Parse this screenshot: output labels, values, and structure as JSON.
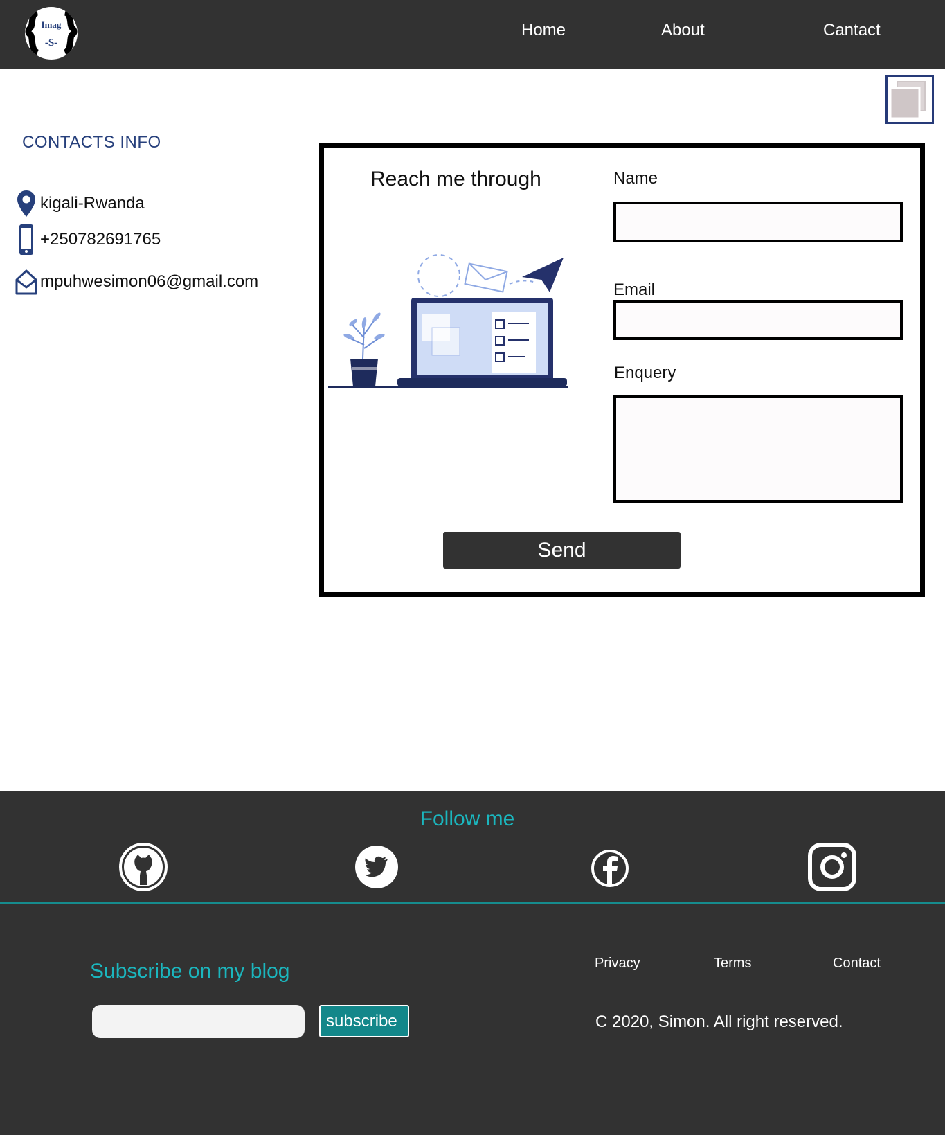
{
  "header": {
    "logo": {
      "line1": "Imag",
      "line2": "-S-",
      "icon": "logo-icon"
    },
    "nav": [
      {
        "label": "Home"
      },
      {
        "label": "About"
      },
      {
        "label": "Cantact"
      }
    ]
  },
  "corner_button": {
    "icon": "copy-icon"
  },
  "contacts": {
    "title": "CONTACTS INFO",
    "items": [
      {
        "icon": "location-pin-icon",
        "text": "kigali-Rwanda"
      },
      {
        "icon": "phone-icon",
        "text": "+250782691765"
      },
      {
        "icon": "envelope-icon",
        "text": "mpuhwesimon06@gmail.com"
      }
    ]
  },
  "form": {
    "title": "Reach me through",
    "illustration": "laptop-mail-illustration",
    "name_label": "Name",
    "name_value": "",
    "email_label": "Email",
    "email_value": "",
    "enquery_label": "Enquery",
    "enquery_value": "",
    "send_label": "Send"
  },
  "footer": {
    "follow_title": "Follow me",
    "social": [
      {
        "icon": "github-icon"
      },
      {
        "icon": "twitter-icon"
      },
      {
        "icon": "facebook-icon"
      },
      {
        "icon": "instagram-icon"
      }
    ],
    "subscribe_title": "Subscribe on my blog",
    "subscribe_value": "",
    "subscribe_label": "subscribe",
    "links": [
      {
        "label": "Privacy"
      },
      {
        "label": "Terms"
      },
      {
        "label": "Contact"
      }
    ],
    "copyright": "C 2020, Simon. All right reserved."
  },
  "colors": {
    "dark": "#323232",
    "accent_teal": "#1bb6be",
    "button_teal": "#13878a",
    "navy": "#27407c"
  }
}
